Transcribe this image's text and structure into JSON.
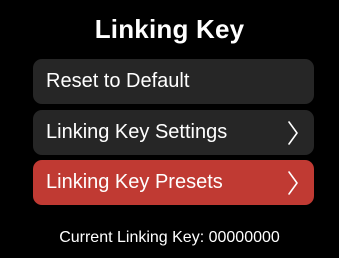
{
  "header": {
    "title": "Linking Key"
  },
  "menu": {
    "items": [
      {
        "label": "Reset to Default",
        "has_chevron": false,
        "selected": false
      },
      {
        "label": "Linking Key Settings",
        "has_chevron": true,
        "selected": false,
        "icon": "chevron-right-icon"
      },
      {
        "label": "Linking Key Presets",
        "has_chevron": true,
        "selected": true,
        "icon": "chevron-right-icon"
      }
    ]
  },
  "footer": {
    "label": "Current Linking Key:",
    "value": "00000000"
  },
  "colors": {
    "background": "#000000",
    "item_background": "#262626",
    "selected_background": "#c03a33",
    "text": "#ffffff"
  }
}
